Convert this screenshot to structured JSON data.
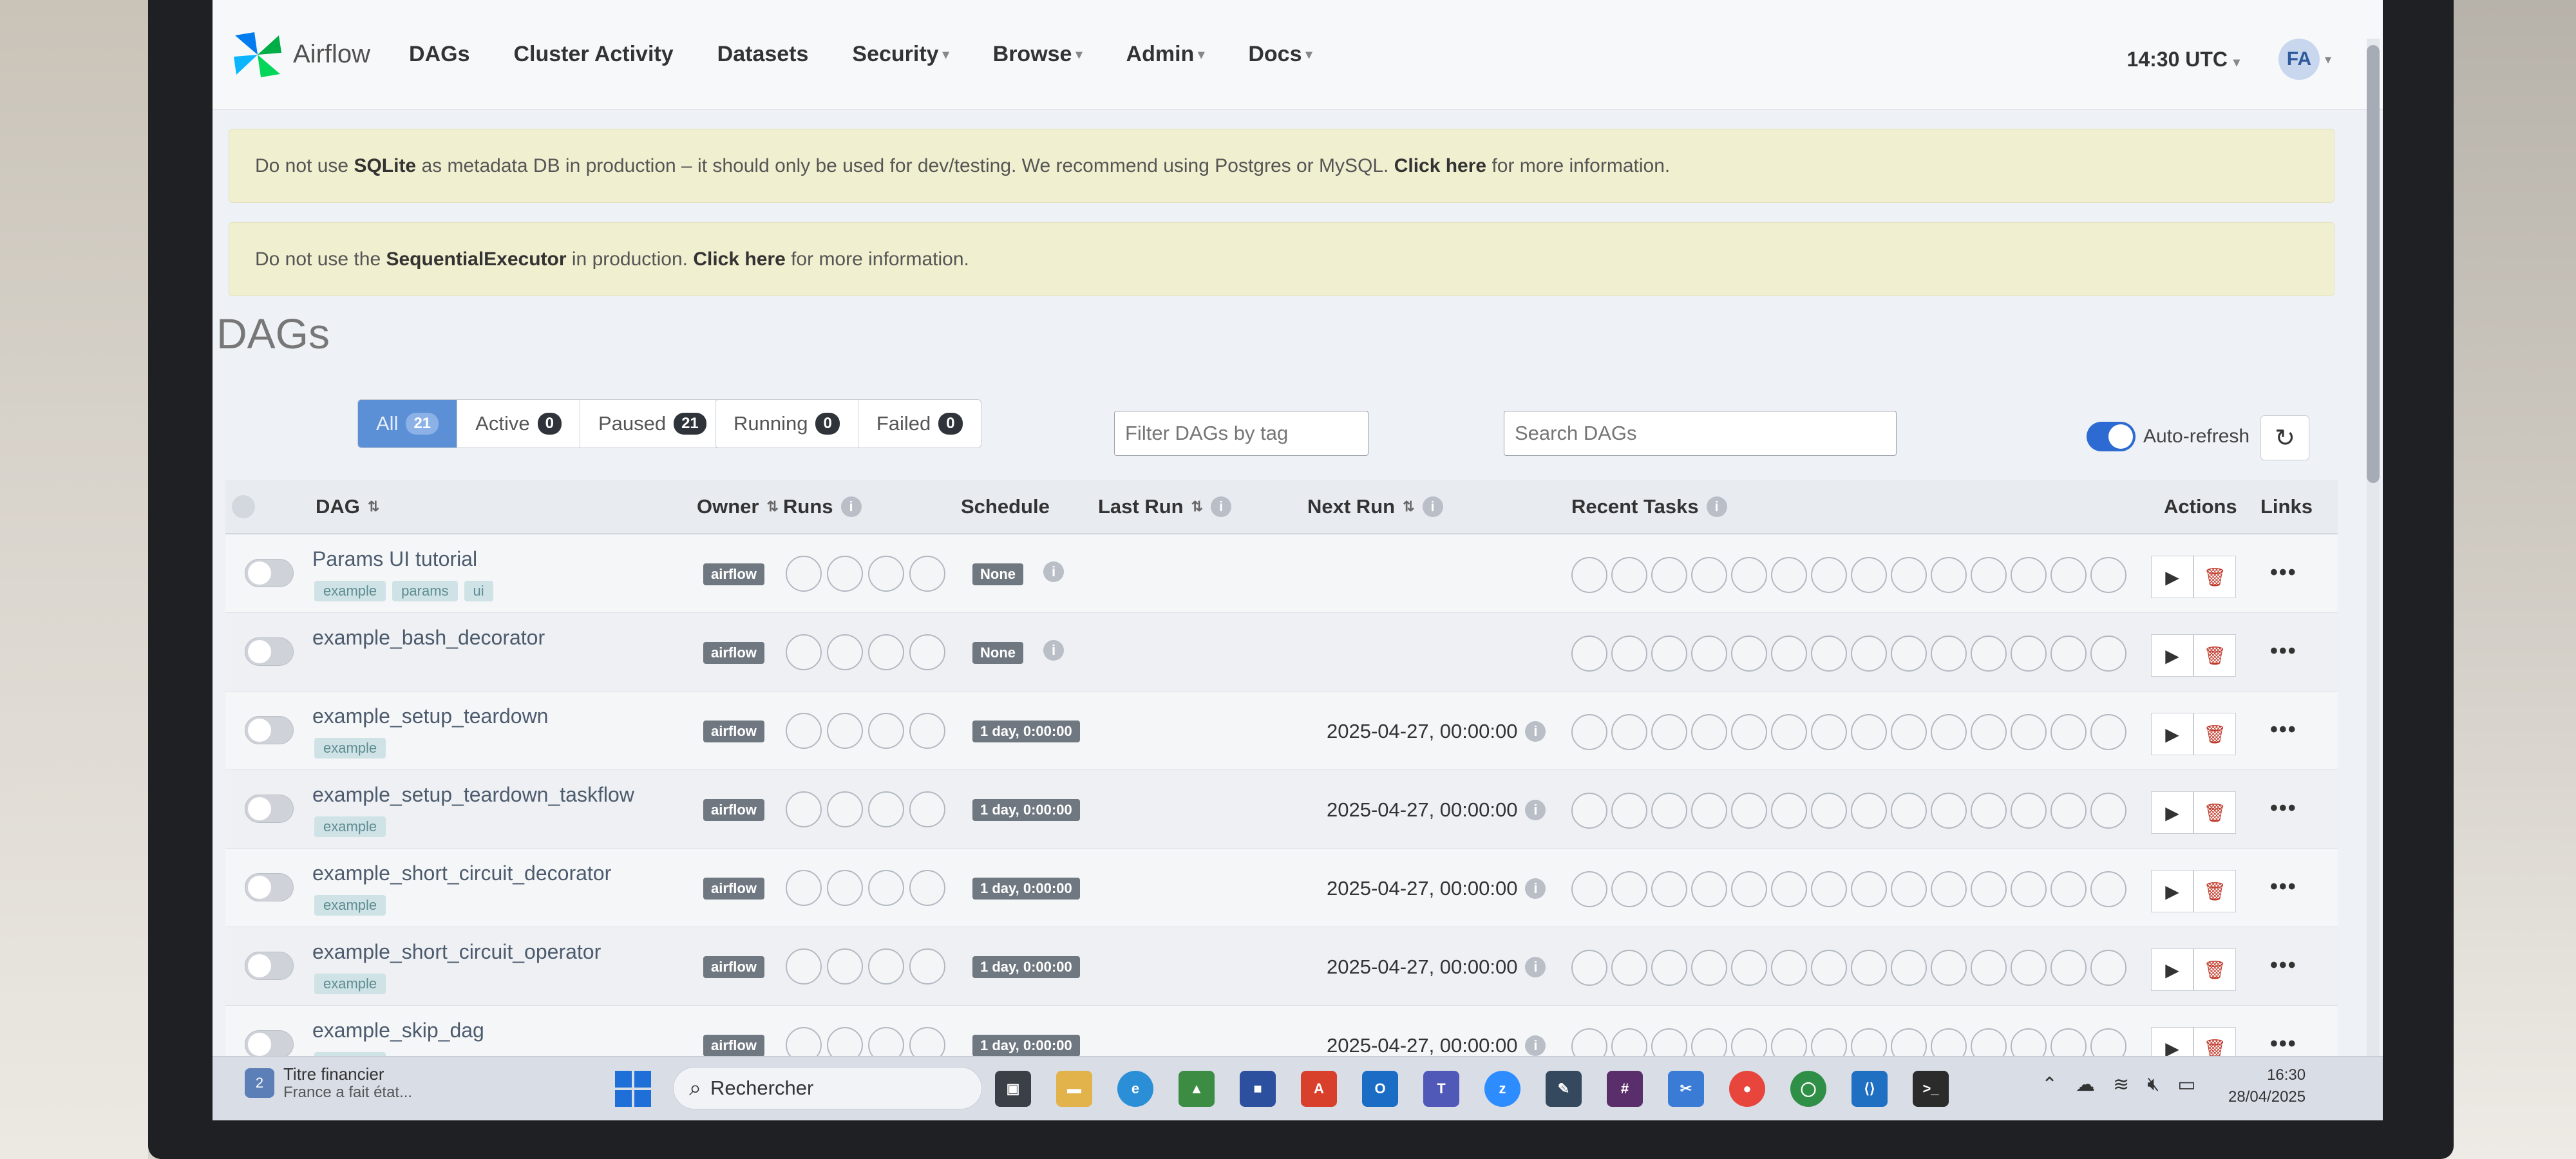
{
  "app": {
    "name": "Airflow"
  },
  "nav": {
    "items": [
      {
        "label": "DAGs",
        "caret": false
      },
      {
        "label": "Cluster Activity",
        "caret": false
      },
      {
        "label": "Datasets",
        "caret": false
      },
      {
        "label": "Security",
        "caret": true
      },
      {
        "label": "Browse",
        "caret": true
      },
      {
        "label": "Admin",
        "caret": true
      },
      {
        "label": "Docs",
        "caret": true
      }
    ],
    "time": "14:30 UTC",
    "user_initials": "FA"
  },
  "alerts": {
    "sqlite": {
      "pre": "Do not use ",
      "bold": "SQLite",
      "mid": " as metadata DB in production – it should only be used for dev/testing. We recommend using Postgres or MySQL. ",
      "link": "Click here",
      "post": " for more information."
    },
    "executor": {
      "pre": "Do not use the ",
      "bold": "SequentialExecutor",
      "mid": " in production. ",
      "link": "Click here",
      "post": " for more information."
    }
  },
  "page": {
    "title": "DAGs"
  },
  "filters": {
    "status": [
      {
        "label": "All",
        "count": "21",
        "active": true
      },
      {
        "label": "Active",
        "count": "0",
        "active": false
      },
      {
        "label": "Paused",
        "count": "21",
        "active": false
      }
    ],
    "runs": [
      {
        "label": "Running",
        "count": "0"
      },
      {
        "label": "Failed",
        "count": "0"
      }
    ],
    "tag_placeholder": "Filter DAGs by tag",
    "search_placeholder": "Search DAGs",
    "autorefresh_label": "Auto-refresh",
    "autorefresh_on": true
  },
  "table": {
    "headers": {
      "dag": "DAG",
      "owner": "Owner",
      "runs": "Runs",
      "schedule": "Schedule",
      "last_run": "Last Run",
      "next_run": "Next Run",
      "recent_tasks": "Recent Tasks",
      "actions": "Actions",
      "links": "Links"
    },
    "rows": [
      {
        "name": "Params UI tutorial",
        "tags": [
          "example",
          "params",
          "ui"
        ],
        "owner": "airflow",
        "schedule": "None",
        "next_run": ""
      },
      {
        "name": "example_bash_decorator",
        "tags": [],
        "owner": "airflow",
        "schedule": "None",
        "next_run": ""
      },
      {
        "name": "example_setup_teardown",
        "tags": [
          "example"
        ],
        "owner": "airflow",
        "schedule": "1 day, 0:00:00",
        "next_run": "2025-04-27, 00:00:00"
      },
      {
        "name": "example_setup_teardown_taskflow",
        "tags": [
          "example"
        ],
        "owner": "airflow",
        "schedule": "1 day, 0:00:00",
        "next_run": "2025-04-27, 00:00:00"
      },
      {
        "name": "example_short_circuit_decorator",
        "tags": [
          "example"
        ],
        "owner": "airflow",
        "schedule": "1 day, 0:00:00",
        "next_run": "2025-04-27, 00:00:00"
      },
      {
        "name": "example_short_circuit_operator",
        "tags": [
          "example"
        ],
        "owner": "airflow",
        "schedule": "1 day, 0:00:00",
        "next_run": "2025-04-27, 00:00:00"
      },
      {
        "name": "example_skip_dag",
        "tags": [
          "example"
        ],
        "owner": "airflow",
        "schedule": "1 day, 0:00:00",
        "next_run": "2025-04-27, 00:00:00"
      }
    ]
  },
  "taskbar": {
    "weather_title": "Titre financier",
    "weather_sub": "France a fait état...",
    "notification_count": "2",
    "search_label": "Rechercher",
    "time": "16:30",
    "date": "28/04/2025"
  },
  "colors": {
    "accent": "#2d6ad2",
    "active_filter": "#5b8fd6",
    "alert_bg": "#f0efcf"
  }
}
